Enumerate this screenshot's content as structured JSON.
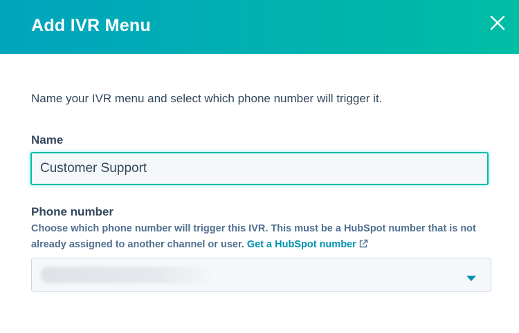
{
  "modal": {
    "title": "Add IVR Menu",
    "close_icon": "close-icon",
    "header_gradient": [
      "#00a4bd",
      "#00bda5"
    ]
  },
  "intro_text": "Name your IVR menu and select which phone number will trigger it.",
  "name_field": {
    "label": "Name",
    "value": "Customer Support",
    "focus_color": "#00bda5"
  },
  "phone_field": {
    "label": "Phone number",
    "help_text": "Choose which phone number will trigger this IVR. This must be a HubSpot number that is not already assigned to another channel or user.",
    "help_link": "Get a HubSpot number",
    "link_icon": "external-link-icon",
    "selected_value_redacted": true,
    "caret_icon": "caret-down-icon",
    "link_color": "#0091ae"
  }
}
